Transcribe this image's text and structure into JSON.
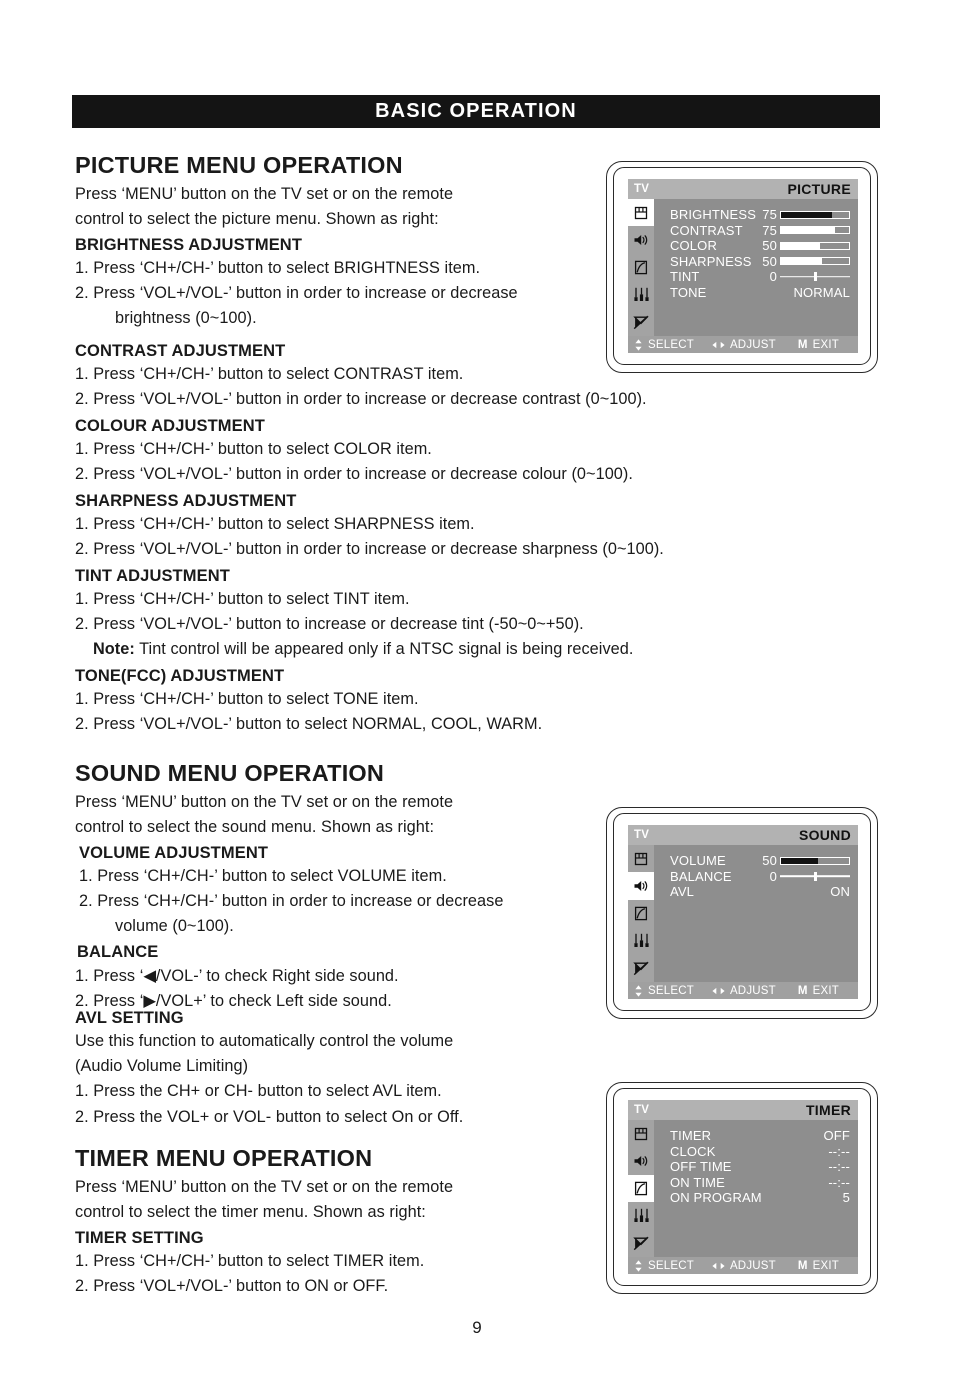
{
  "banner": {
    "title": "BASIC OPERATION"
  },
  "page_number": "9",
  "sections": {
    "picture": {
      "title": "PICTURE MENU OPERATION",
      "intro_line1": "Press ‘MENU’  button on the TV set or on the remote",
      "intro_line2": "control to select the picture menu. Shown as right:",
      "brightness": {
        "heading": "BRIGHTNESS  ADJUSTMENT",
        "step1": "1. Press ‘CH+/CH-’  button to select BRIGHTNESS item.",
        "step2": "2. Press ‘VOL+/VOL-’  button in order to increase or decrease",
        "step2b": "brightness (0~100)."
      },
      "contrast": {
        "heading": "CONTRAST ADJUSTMENT",
        "step1": "1. Press ‘CH+/CH-’  button to select CONTRAST item.",
        "step2": "2. Press ‘VOL+/VOL-’  button in order to increase or decrease contrast (0~100)."
      },
      "colour": {
        "heading": "COLOUR ADJUSTMENT",
        "step1": "1. Press ‘CH+/CH-’  button to select COLOR item.",
        "step2": "2. Press ‘VOL+/VOL-’  button in order to increase or decrease colour (0~100)."
      },
      "sharpness": {
        "heading": "SHARPNESS ADJUSTMENT",
        "step1": "1. Press ‘CH+/CH-’  button to select SHARPNESS item.",
        "step2": "2. Press ‘VOL+/VOL-’  button in order to increase or decrease sharpness (0~100)."
      },
      "tint": {
        "heading": "TINT ADJUSTMENT",
        "step1": "1. Press ‘CH+/CH-’  button to select TINT item.",
        "step2": "2. Press ‘VOL+/VOL-’  button to increase or decrease tint (-50~0~+50).",
        "note_label": "Note:",
        "note_text": " Tint control will be appeared only if a NTSC signal is being received."
      },
      "tone": {
        "heading": "TONE(FCC)  ADJUSTMENT",
        "step1": "1. Press ‘CH+/CH-’  button to select TONE item.",
        "step2": "2. Press ‘VOL+/VOL-’  button to select NORMAL, COOL, WARM."
      }
    },
    "sound": {
      "title": "SOUND MENU OPERATION",
      "intro_line1": "Press ‘MENU’  button on the TV set or on the remote",
      "intro_line2": "control to select the sound menu. Shown as right:",
      "volume": {
        "heading": "VOLUME ADJUSTMENT",
        "step1": "1. Press ‘CH+/CH-’  button to select VOLUME item.",
        "step2": "2. Press ‘CH+/CH-’  button in order to increase or decrease",
        "step2b": "volume (0~100)."
      },
      "balance": {
        "heading": "BALANCE",
        "step1": "1. Press ‘◀/VOL-’  to check Right side sound.",
        "step2": "2. Press ‘▶/VOL+’  to check Left side sound."
      },
      "avl": {
        "heading": "AVL SETTING",
        "desc_line1": "Use this function to automatically control the volume",
        "desc_line2": "(Audio Volume Limiting)",
        "step1": "1.  Press the CH+ or CH- button to select AVL item.",
        "step2": "2.  Press the VOL+ or  VOL- button to select On or Off."
      }
    },
    "timer": {
      "title": "TIMER MENU OPERATION",
      "intro_line1": "Press ‘MENU’  button on the TV set or on the remote",
      "intro_line2": "control to select the timer menu. Shown as right:",
      "setting": {
        "heading": "TIMER SETTING",
        "step1": "1. Press ‘CH+/CH-’  button to select TIMER item.",
        "step2": "2. Press ‘VOL+/VOL-’  button to ON or OFF."
      }
    }
  },
  "osd_common": {
    "source": "TV",
    "footer": {
      "select": "SELECT",
      "adjust": "ADJUST",
      "exit_key": "M",
      "exit": "EXIT"
    },
    "rail_icons": [
      "picture-icon",
      "speaker-icon",
      "timer-clock-icon",
      "equalizer-icon",
      "mute-antenna-icon"
    ]
  },
  "osd_picture": {
    "menu_name": "PICTURE",
    "active_rail_index": 0,
    "rows": [
      {
        "label": "BRIGHTNESS",
        "value": "75",
        "type": "meter",
        "percent": 75,
        "selected": true
      },
      {
        "label": "CONTRAST",
        "value": "75",
        "type": "meter",
        "percent": 80,
        "selected": false
      },
      {
        "label": "COLOR",
        "value": "50",
        "type": "meter",
        "percent": 57,
        "selected": false
      },
      {
        "label": "SHARPNESS",
        "value": "50",
        "type": "meter",
        "percent": 60,
        "selected": false
      },
      {
        "label": "TINT",
        "value": "0",
        "type": "tick",
        "percent": 50,
        "selected": false
      },
      {
        "label": "TONE",
        "value": "NORMAL",
        "type": "text",
        "selected": false
      }
    ]
  },
  "osd_sound": {
    "menu_name": "SOUND",
    "active_rail_index": 1,
    "rows": [
      {
        "label": "VOLUME",
        "value": "50",
        "type": "meter",
        "percent": 55,
        "selected": true
      },
      {
        "label": "BALANCE",
        "value": "0",
        "type": "tick",
        "percent": 50,
        "selected": false
      },
      {
        "label": "AVL",
        "value": "ON",
        "type": "text",
        "selected": false
      }
    ]
  },
  "osd_timer": {
    "menu_name": "TIMER",
    "active_rail_index": 2,
    "rows": [
      {
        "label": "TIMER",
        "value": "OFF",
        "type": "text",
        "selected": false
      },
      {
        "label": "CLOCK",
        "value": "--:--",
        "type": "text",
        "selected": false
      },
      {
        "label": "OFF TIME",
        "value": "--:--",
        "type": "text",
        "selected": false
      },
      {
        "label": "ON TIME",
        "value": "--:--",
        "type": "text",
        "selected": false
      },
      {
        "label": "ON PROGRAM",
        "value": "5",
        "type": "text",
        "selected": false
      }
    ]
  },
  "colors": {
    "banner_bg": "#141414",
    "osd_bg": "#8e8e8e",
    "osd_header_bg": "#b2b2b2",
    "osd_rail_bg": "#a3a3a3",
    "osd_footer_bg": "#a0a0a0",
    "osd_text": "#ffffff",
    "selected_fill": "#121212"
  }
}
